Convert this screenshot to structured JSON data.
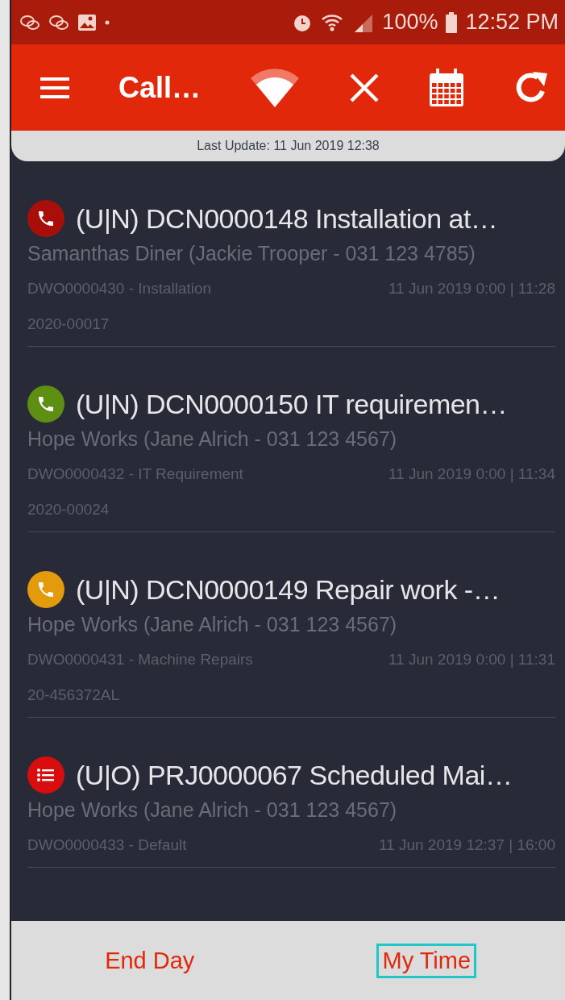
{
  "status_bar": {
    "battery": "100%",
    "time": "12:52 PM"
  },
  "header": {
    "title": "Call…"
  },
  "last_update": "Last Update: 11 Jun 2019 12:38",
  "calls": [
    {
      "kind": "phone",
      "color": "#a90f0a",
      "title": "(U|N) DCN0000148 Installation at…",
      "customer": "Samanthas Diner (Jackie Trooper - 031 123 4785)",
      "work_order": "DWO0000430 - Installation",
      "date": "11 Jun 2019 0:00 | 11:28",
      "reference": "2020-00017"
    },
    {
      "kind": "phone",
      "color": "#5e8f12",
      "title": "(U|N) DCN0000150 IT requiremen…",
      "customer": "Hope Works (Jane Alrich - 031 123 4567)",
      "work_order": "DWO0000432 - IT Requirement",
      "date": "11 Jun 2019 0:00 | 11:34",
      "reference": "2020-00024"
    },
    {
      "kind": "phone",
      "color": "#e39a0c",
      "title": "(U|N) DCN0000149 Repair work -…",
      "customer": "Hope Works (Jane Alrich - 031 123 4567)",
      "work_order": "DWO0000431 - Machine Repairs",
      "date": "11 Jun 2019 0:00 | 11:31",
      "reference": "20-456372AL"
    },
    {
      "kind": "list",
      "color": "#d90d0d",
      "title": "(U|O) PRJ0000067 Scheduled Mai…",
      "customer": "Hope Works (Jane Alrich - 031 123 4567)",
      "work_order": "DWO0000433 - Default",
      "date": "11 Jun 2019 12:37 | 16:00"
    }
  ],
  "footer": [
    {
      "label": "End Day",
      "focused": false
    },
    {
      "label": "My Time",
      "focused": true
    }
  ]
}
